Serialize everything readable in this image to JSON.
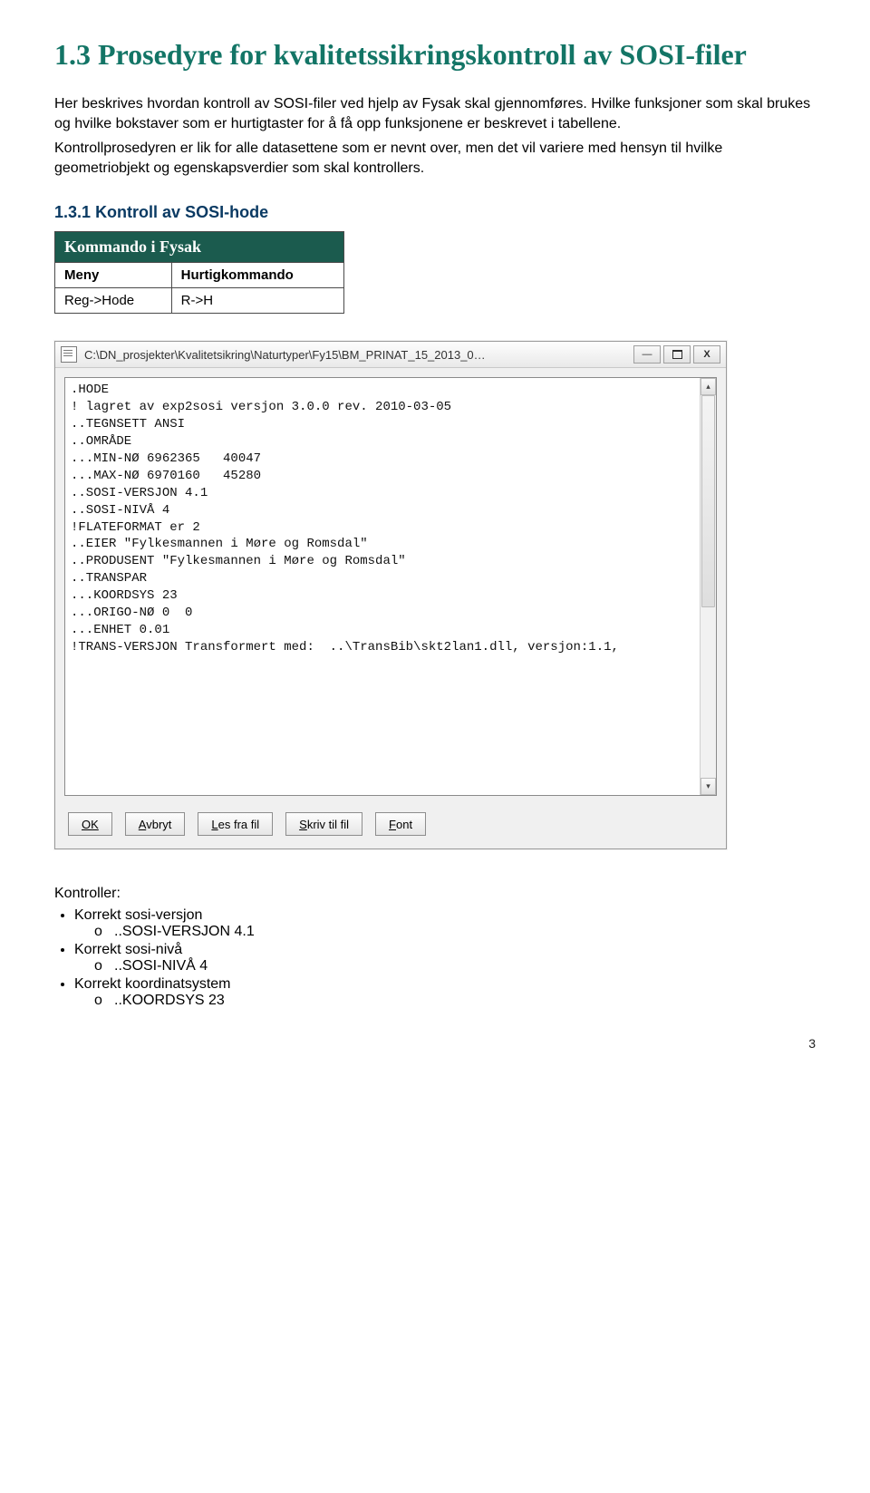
{
  "section": {
    "number": "1.3",
    "title": "Prosedyre for kvalitetssikringskontroll av SOSI-filer"
  },
  "paragraphs": {
    "p1": "Her beskrives hvordan kontroll av SOSI-filer ved hjelp av Fysak skal gjennomføres. Hvilke funksjoner som skal brukes og hvilke bokstaver som er hurtigtaster for å få opp funksjonene er beskrevet i tabellene.",
    "p2": "Kontrollprosedyren er lik for alle datasettene som er nevnt over, men det vil variere med hensyn til hvilke geometriobjekt og egenskapsverdier som skal kontrollers."
  },
  "subsection": {
    "number": "1.3.1",
    "title": "Kontroll av SOSI-hode"
  },
  "cmd_table": {
    "header": "Kommando i Fysak",
    "col1": "Meny",
    "col2": "Hurtigkommando",
    "val1": "Reg->Hode",
    "val2": "R->H"
  },
  "dialog": {
    "title_path": "C:\\DN_prosjekter\\Kvalitetsikring\\Naturtyper\\Fy15\\BM_PRINAT_15_2013_0…",
    "code": ".HODE\n! lagret av exp2sosi versjon 3.0.0 rev. 2010-03-05\n..TEGNSETT ANSI\n..OMRÅDE\n...MIN-NØ 6962365   40047\n...MAX-NØ 6970160   45280\n..SOSI-VERSJON 4.1\n..SOSI-NIVÅ 4\n!FLATEFORMAT er 2\n..EIER \"Fylkesmannen i Møre og Romsdal\"\n..PRODUSENT \"Fylkesmannen i Møre og Romsdal\"\n..TRANSPAR\n...KOORDSYS 23\n...ORIGO-NØ 0  0\n...ENHET 0.01\n!TRANS-VERSJON Transformert med:  ..\\TransBib\\skt2lan1.dll, versjon:1.1,",
    "buttons": {
      "ok": "OK",
      "cancel_pre": "A",
      "cancel_rest": "vbryt",
      "read_pre": "L",
      "read_rest": "es fra fil",
      "write_pre": "S",
      "write_rest": "kriv til fil",
      "font_pre": "F",
      "font_rest": "ont"
    },
    "win": {
      "minimize": "—",
      "close": "X"
    }
  },
  "controllers": {
    "title": "Kontroller:",
    "items": [
      {
        "label": "Korrekt sosi-versjon",
        "sub": "..SOSI-VERSJON 4.1"
      },
      {
        "label": "Korrekt sosi-nivå",
        "sub": "..SOSI-NIVÅ 4"
      },
      {
        "label": "Korrekt koordinatsystem",
        "sub": "..KOORDSYS 23"
      }
    ]
  },
  "page_number": "3"
}
